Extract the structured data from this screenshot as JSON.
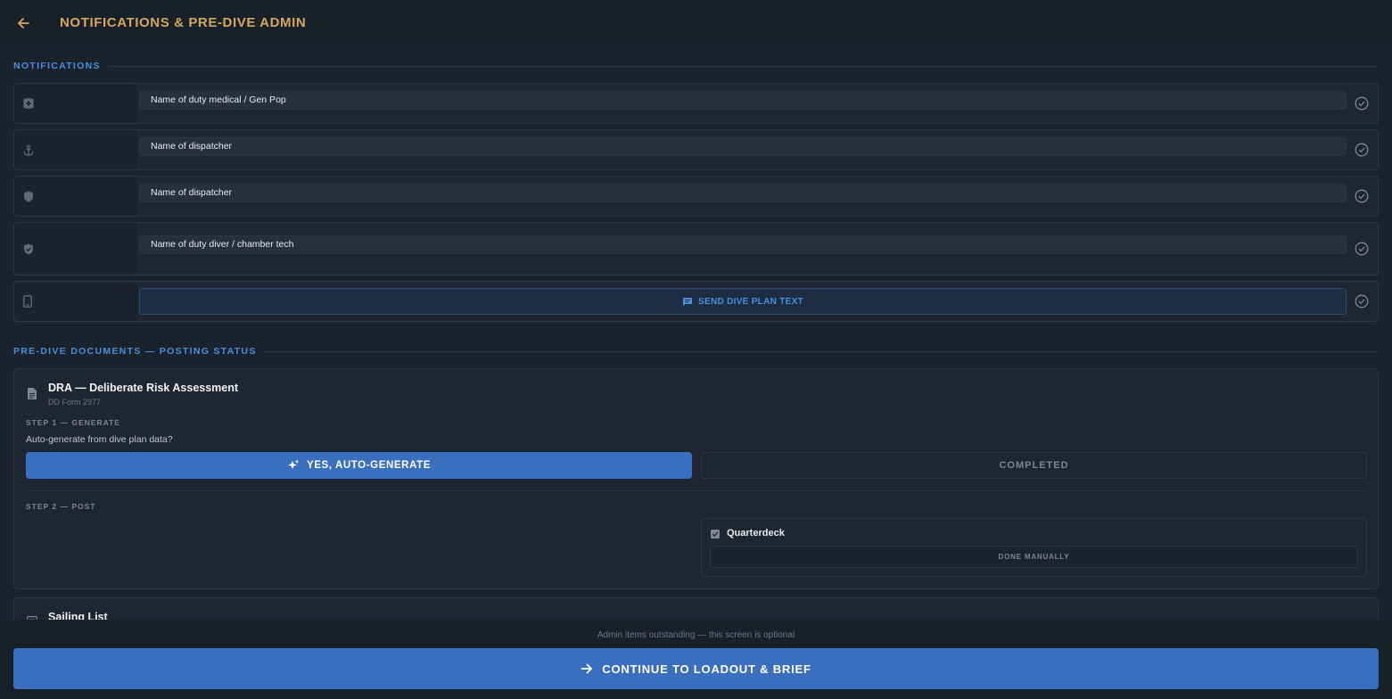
{
  "header": {
    "title": "NOTIFICATIONS & PRE-DIVE ADMIN"
  },
  "notifications": {
    "section_label": "NOTIFICATIONS",
    "rows": [
      {
        "icon": "medical-cross-icon",
        "value": "Name of duty medical / Gen Pop"
      },
      {
        "icon": "anchor-icon",
        "value": "Name of dispatcher"
      },
      {
        "icon": "shield-icon",
        "value": "Name of dispatcher"
      },
      {
        "icon": "shield-check-icon",
        "value": "Name of duty diver / chamber tech"
      }
    ],
    "send": {
      "icon": "phone-icon",
      "label": "SEND DIVE PLAN TEXT"
    }
  },
  "documents": {
    "section_label": "PRE-DIVE DOCUMENTS — POSTING STATUS",
    "dra": {
      "title": "DRA — Deliberate Risk Assessment",
      "subtitle": "DD Form 2977",
      "step1_label": "STEP 1 — GENERATE",
      "step1_question": "Auto-generate from dive plan data?",
      "auto_generate_label": "YES, AUTO-GENERATE",
      "completed_label": "COMPLETED",
      "step2_label": "STEP 2 — POST",
      "location_label": "Quarterdeck",
      "done_manually_label": "DONE MANUALLY"
    },
    "sailing": {
      "title": "Sailing List"
    }
  },
  "footer": {
    "note": "Admin items outstanding — this screen is optional",
    "continue_label": "CONTINUE TO LOADOUT & BRIEF"
  },
  "colors": {
    "accent": "#3a6fbf",
    "gold": "#d4a85c",
    "section_blue": "#4a8fd8",
    "background": "#1a222d"
  }
}
